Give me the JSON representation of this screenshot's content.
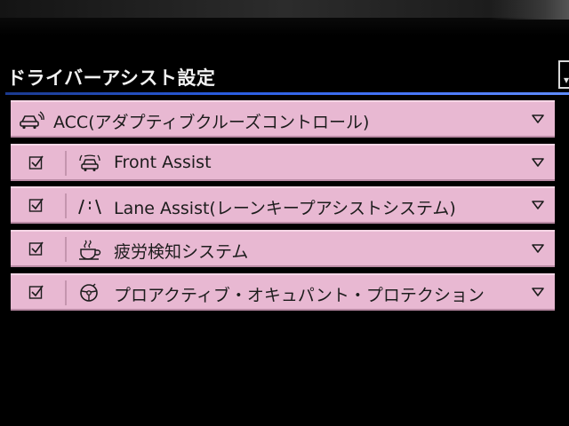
{
  "header": {
    "title": "ドライバーアシスト設定"
  },
  "rows": [
    {
      "label": "ACC(アダプティブクルーズコントロール)",
      "icon": "acc-car-icon",
      "checked": null
    },
    {
      "label": "Front Assist",
      "icon": "front-assist-icon",
      "checked": true
    },
    {
      "label": "Lane Assist(レーンキープアシストシステム)",
      "icon": "lane-assist-icon",
      "checked": true
    },
    {
      "label": "疲労検知システム",
      "icon": "coffee-cup-icon",
      "checked": true
    },
    {
      "label": "プロアクティブ・オキュパント・プロテクション",
      "icon": "steering-wheel-icon",
      "checked": true
    }
  ],
  "colors": {
    "row_bg": "#e8b8d2",
    "accent_rule": "#2a5de0",
    "title_text": "#f2f2f2"
  }
}
